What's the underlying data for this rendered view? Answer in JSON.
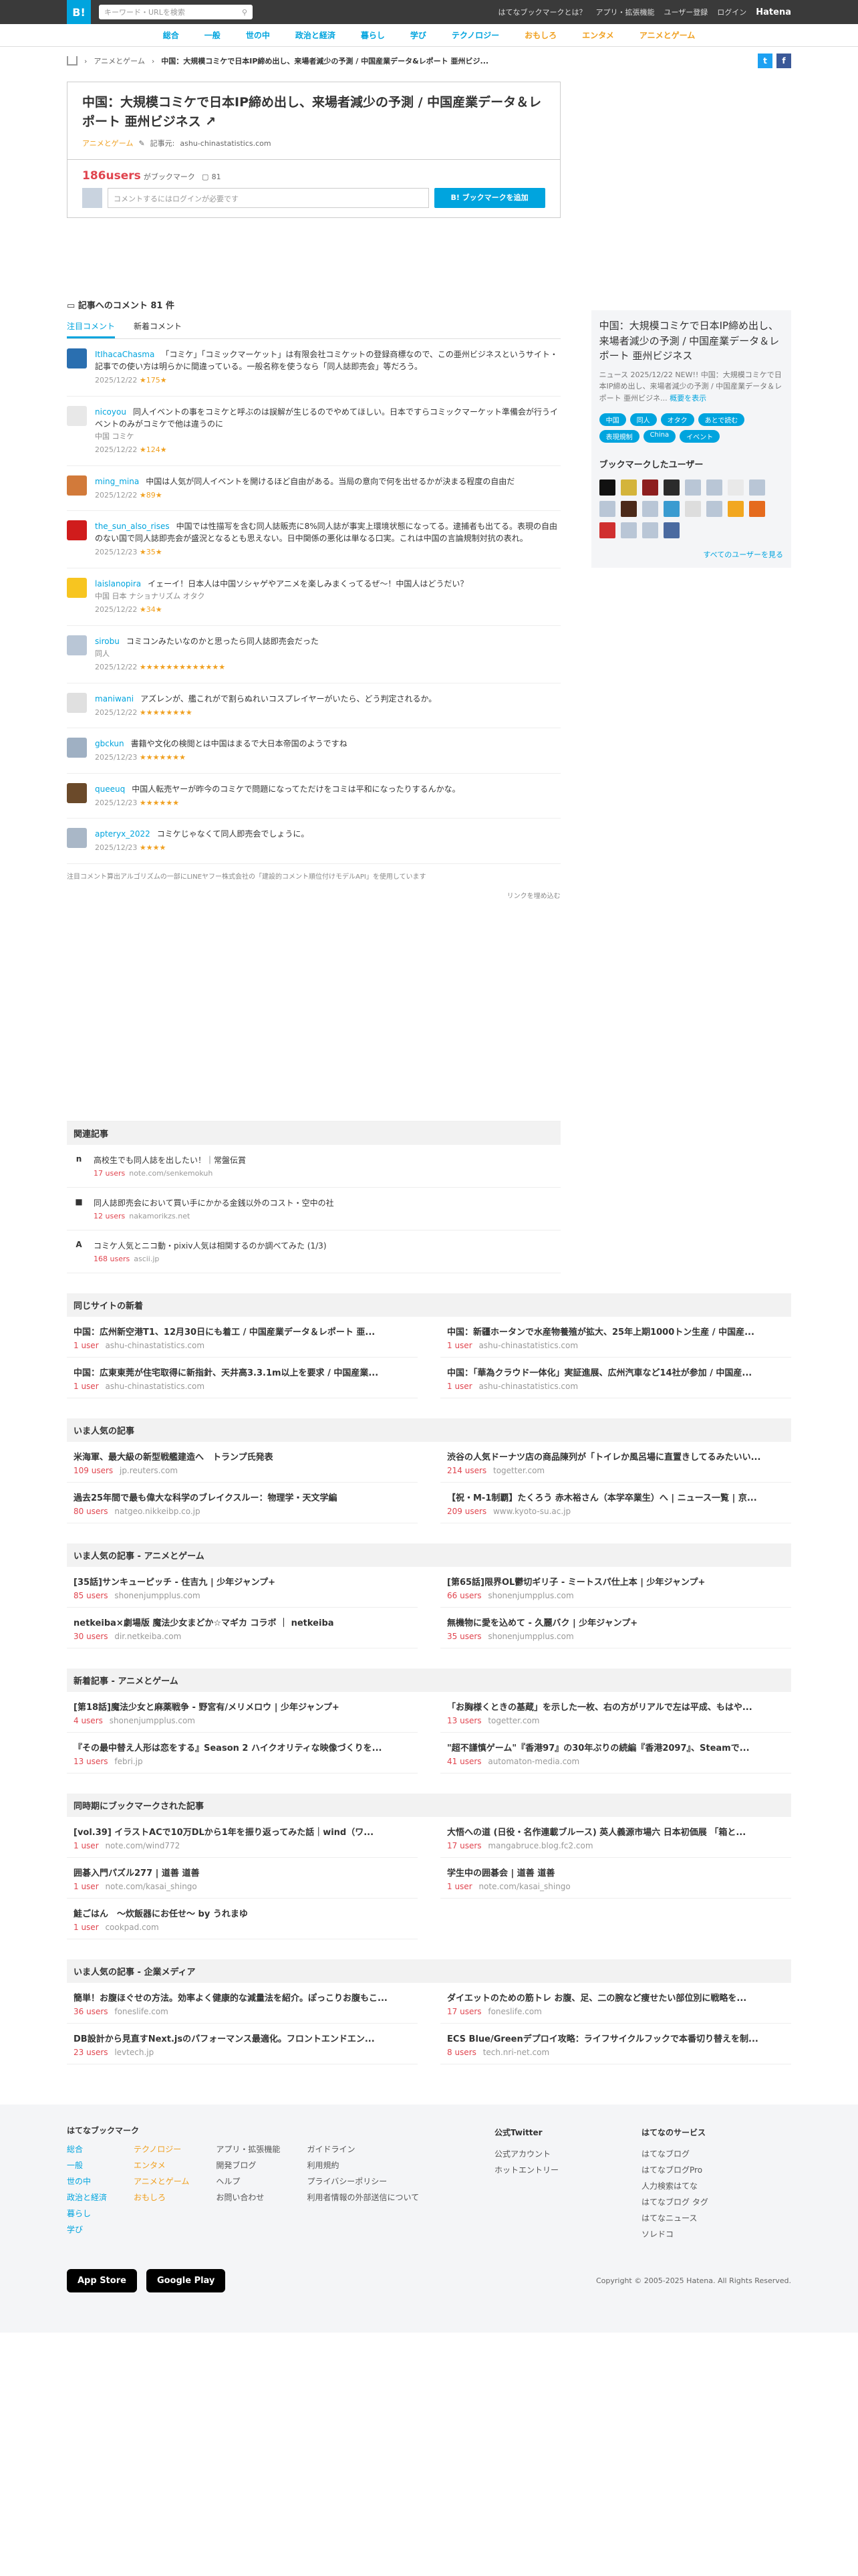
{
  "topbar": {
    "logo": "B!",
    "search_placeholder": "キーワード・URLを検索",
    "links": [
      "はてなブックマークとは？",
      "アプリ・拡張機能",
      "ユーザー登録",
      "ログイン"
    ],
    "brand": "Hatena"
  },
  "categories": [
    "総合",
    "一般",
    "世の中",
    "政治と経済",
    "暮らし",
    "学び",
    "テクノロジー",
    "おもしろ",
    "エンタメ",
    "アニメとゲーム"
  ],
  "breadcrumb": {
    "cat": "アニメとゲーム",
    "title": "中国：大規模コミケで日本IP締め出し、来場者減少の予測 / 中国産業データ&レポート 亜州ビジ..."
  },
  "entry": {
    "title": "中国：大規模コミケで日本IP締め出し、来場者減少の予測 / 中国産業データ＆レポート 亜州ビジネス",
    "category": "アニメとゲーム",
    "author_label": "記事元:",
    "site": "ashu-chinastatistics.com",
    "users": "186users",
    "users_suffix": "がブックマーク",
    "comments_count": "81",
    "comment_placeholder": "コメントするにはログインが必要です",
    "bookmark_button": "B! ブックマークを追加"
  },
  "comments_section": {
    "title": "記事へのコメント 81 件",
    "tab1": "注目コメント",
    "tab2": "新着コメント"
  },
  "comments": [
    {
      "user": "ItIhacaChasma",
      "text": "「コミケ」「コミックマーケット」は有限会社コミケットの登録商標なので、この亜州ビジネスというサイト・記事での使い方は明らかに間違っている。一般名称を使うなら「同人誌即売会」等だろう。",
      "tags": "",
      "date": "2025/12/22",
      "stars": "★175★"
    },
    {
      "user": "nicoyou",
      "text": "同人イベントの事をコミケと呼ぶのは誤解が生じるのでやめてほしい。日本ですらコミックマーケット準備会が行うイベントのみがコミケで他は違うのに",
      "tags": "中国 コミケ",
      "date": "2025/12/22",
      "stars": "★124★"
    },
    {
      "user": "ming_mina",
      "text": "中国は人気が同人イベントを開けるほど自由がある。当局の意向で何を出せるかが決まる程度の自由だ",
      "tags": "",
      "date": "2025/12/22",
      "stars": "★89★"
    },
    {
      "user": "the_sun_also_rises",
      "text": "中国では性描写を含む同人誌販売に8%同人誌が事実上環境状態になってる。逮捕者も出てる。表現の自由のない国で同人誌即売会が盛況となるとも思えない。日中関係の悪化は単なる口実。これは中国の言論規制対抗の表れ。",
      "tags": "",
      "date": "2025/12/23",
      "stars": "★35★"
    },
    {
      "user": "laislanopira",
      "text": "イェーイ！日本人は中国ソシャゲやアニメを楽しみまくってるぜ〜！中国人はどうだい？",
      "tags": "中国 日本 ナショナリズム オタク",
      "date": "2025/12/22",
      "stars": "★34★"
    },
    {
      "user": "sirobu",
      "text": "コミコンみたいなのかと思ったら同人誌即売会だった",
      "tags": "同人",
      "date": "2025/12/22",
      "stars": "★★★★★★★★★★★★★"
    },
    {
      "user": "maniwani",
      "text": "アズレンが、艦これがで割らぬれいコスプレイヤーがいたら、どう判定されるか。",
      "tags": "",
      "date": "2025/12/22",
      "stars": "★★★★★★★★"
    },
    {
      "user": "gbckun",
      "text": "書籍や文化の検閲とは中国はまるで大日本帝国のようですね",
      "tags": "",
      "date": "2025/12/23",
      "stars": "★★★★★★★"
    },
    {
      "user": "queeuq",
      "text": "中国人転売ヤーが昨今のコミケで問題になってただけをコミは平和になったりするんかな。",
      "tags": "",
      "date": "2025/12/23",
      "stars": "★★★★★★"
    },
    {
      "user": "apteryx_2022",
      "text": "コミケじゃなくて同人即売会でしょうに。",
      "tags": "",
      "date": "2025/12/23",
      "stars": "★★★★"
    }
  ],
  "comments_note": "注目コメント算出アルゴリズムの一部にLINEヤフー株式会社の「建設的コメント順位付けモデルAPI」を使用しています",
  "more_link": "リンクを埋め込む",
  "sidebar": {
    "title": "中国：大規模コミケで日本IP締め出し、来場者減少の予測 / 中国産業データ＆レポート 亜州ビジネス",
    "desc": "ニュース 2025/12/22 NEW!! 中国：大規模コミケで日本IP締め出し、来場者減少の予測 / 中国産業データ＆レポート 亜州ビジネ...",
    "more": "概要を表示",
    "tags": [
      "中国",
      "同人",
      "オタク",
      "あとで読む",
      "表現規制",
      "China",
      "イベント"
    ],
    "bmusers_title": "ブックマークしたユーザー",
    "all_users": "すべてのユーザーを見る"
  },
  "related": {
    "title": "関連記事",
    "items": [
      {
        "icon": "n",
        "title": "高校生でも同人誌を出したい！｜常盤伝賞",
        "users": "17 users",
        "domain": "note.com/senkemokuh"
      },
      {
        "icon": "■",
        "title": "同人誌即売会において買い手にかかる金銭以外のコスト・空中の社",
        "users": "12 users",
        "domain": "nakamorikzs.net"
      },
      {
        "icon": "A",
        "title": "コミケ人気とニコ動・pixiv人気は相関するのか調べてみた (1/3)",
        "users": "168 users",
        "domain": "ascii.jp"
      }
    ]
  },
  "sections": [
    {
      "title": "同じサイトの新着",
      "items": [
        {
          "title": "中国：広州新空港T1、12月30日にも着工 / 中国産業データ＆レポート 亜...",
          "users": "1 user",
          "domain": "ashu-chinastatistics.com"
        },
        {
          "title": "中国：新疆ホータンで水産物養殖が拡大、25年上期1000トン生産 / 中国産...",
          "users": "1 user",
          "domain": "ashu-chinastatistics.com"
        },
        {
          "title": "中国：広東東莞が住宅取得に新指針、天井高3.3.1m以上を要求 / 中国産業...",
          "users": "1 user",
          "domain": "ashu-chinastatistics.com"
        },
        {
          "title": "中国：「華為クラウド一体化」実証進展、広州汽車など14社が参加 / 中国産...",
          "users": "1 user",
          "domain": "ashu-chinastatistics.com"
        }
      ]
    },
    {
      "title": "いま人気の記事",
      "items": [
        {
          "title": "米海軍、最大級の新型戦艦建造へ　トランプ氏発表",
          "users": "109 users",
          "domain": "jp.reuters.com"
        },
        {
          "title": "渋谷の人気ドーナツ店の商品陳列が「トイレか風呂場に直置きしてるみたいい...",
          "users": "214 users",
          "domain": "togetter.com"
        },
        {
          "title": "過去25年間で最も偉大な科学のブレイクスルー：物理学・天文学編",
          "users": "80 users",
          "domain": "natgeo.nikkeibp.co.jp"
        },
        {
          "title": "【祝・M-1制覇】たくろう 赤木裕さん（本学卒業生）へ | ニュース一覧 | 京...",
          "users": "209 users",
          "domain": "www.kyoto-su.ac.jp"
        }
      ]
    },
    {
      "title": "いま人気の記事 - アニメとゲーム",
      "items": [
        {
          "title": "[35話]サンキューピッチ - 住吉九 | 少年ジャンプ+",
          "users": "85 users",
          "domain": "shonenjumpplus.com"
        },
        {
          "title": "[第65話]限界OL鬱切ギリ子 - ミートスパ仕上本 | 少年ジャンプ+",
          "users": "66 users",
          "domain": "shonenjumpplus.com"
        },
        {
          "title": "netkeiba×劇場版 魔法少女まどか☆マギカ コラボ ｜ netkeiba",
          "users": "30 users",
          "domain": "dir.netkeiba.com"
        },
        {
          "title": "無機物に愛を込めて - 久麗バク | 少年ジャンプ+",
          "users": "35 users",
          "domain": "shonenjumpplus.com"
        }
      ]
    },
    {
      "title": "新着記事 - アニメとゲーム",
      "items": [
        {
          "title": "[第18話]魔法少女と麻薬戦争 - 野宮有/メリメロウ | 少年ジャンプ+",
          "users": "4 users",
          "domain": "shonenjumpplus.com"
        },
        {
          "title": "「お胸様くときの基蔵」を示した一枚、右の方がリアルで左は平成、もはや...",
          "users": "13 users",
          "domain": "togetter.com"
        },
        {
          "title": "『その最中替え人形は恋をする』Season 2 ハイクオリティな映像づくりを...",
          "users": "13 users",
          "domain": "febri.jp"
        },
        {
          "title": "\"超不謹慎ゲーム\"『香港97』の30年ぶりの続編『香港2097』、Steamで...",
          "users": "41 users",
          "domain": "automaton-media.com"
        }
      ]
    },
    {
      "title": "同時期にブックマークされた記事",
      "items": [
        {
          "title": "[vol.39] イラストACで10万DLから1年を振り返ってみた話｜wind（ワ...",
          "users": "1 user",
          "domain": "note.com/wind772"
        },
        {
          "title": "大悟への道 (日役・名作連載ブルース) 英人義源市場六 日本初価展 「箱と...",
          "users": "17 users",
          "domain": "mangabruce.blog.fc2.com"
        },
        {
          "title": "囲碁入門パズル277 | 道善 道善",
          "users": "1 user",
          "domain": "note.com/kasai_shingo"
        },
        {
          "title": "学生中の囲碁会 | 道善 道善",
          "users": "1 user",
          "domain": "note.com/kasai_shingo"
        },
        {
          "title": "鮭ごはん　〜炊飯器にお任せ〜 by うれまゆ",
          "users": "1 user",
          "domain": "cookpad.com"
        }
      ]
    },
    {
      "title": "いま人気の記事 - 企業メディア",
      "items": [
        {
          "title": "簡単！お腹ほぐせの方法。効率よく健康的な減量法を紹介。ぽっこりお腹もこ...",
          "users": "36 users",
          "domain": "foneslife.com"
        },
        {
          "title": "ダイエットのための筋トレ お腹、足、二の腕など痩せたい部位別に戦略を...",
          "users": "17 users",
          "domain": "foneslife.com"
        },
        {
          "title": "DB設計から見直すNext.jsのパフォーマンス最適化。フロントエンドエン...",
          "users": "23 users",
          "domain": "levtech.jp"
        },
        {
          "title": "ECS Blue/Greenデプロイ攻略：ライフサイクルフックで本番切り替えを制...",
          "users": "8 users",
          "domain": "tech.nri-net.com"
        }
      ]
    }
  ],
  "footer": {
    "col1_title": "はてなブックマーク",
    "col1a": [
      "総合",
      "一般",
      "世の中",
      "政治と経済",
      "暮らし",
      "学び"
    ],
    "col1b": [
      "テクノロジー",
      "エンタメ",
      "アニメとゲーム",
      "おもしろ"
    ],
    "col1c": [
      "アプリ・拡張機能",
      "開発ブログ",
      "ヘルプ",
      "お問い合わせ"
    ],
    "col1d": [
      "ガイドライン",
      "利用規約",
      "プライバシーポリシー",
      "利用者情報の外部送信について"
    ],
    "col2_title": "公式Twitter",
    "col2": [
      "公式アカウント",
      "ホットエントリー"
    ],
    "col3_title": "はてなのサービス",
    "col3": [
      "はてなブログ",
      "はてなブログPro",
      "人力検索はてな",
      "はてなブログ タグ",
      "はてなニュース",
      "ソレドコ"
    ],
    "appstore": "App Store",
    "googleplay": "Google Play",
    "copyright": "Copyright © 2005-2025 Hatena. All Rights Reserved."
  },
  "colors": {
    "accent": "#00a4de",
    "users": "#e0444e",
    "star": "#f0a020"
  }
}
